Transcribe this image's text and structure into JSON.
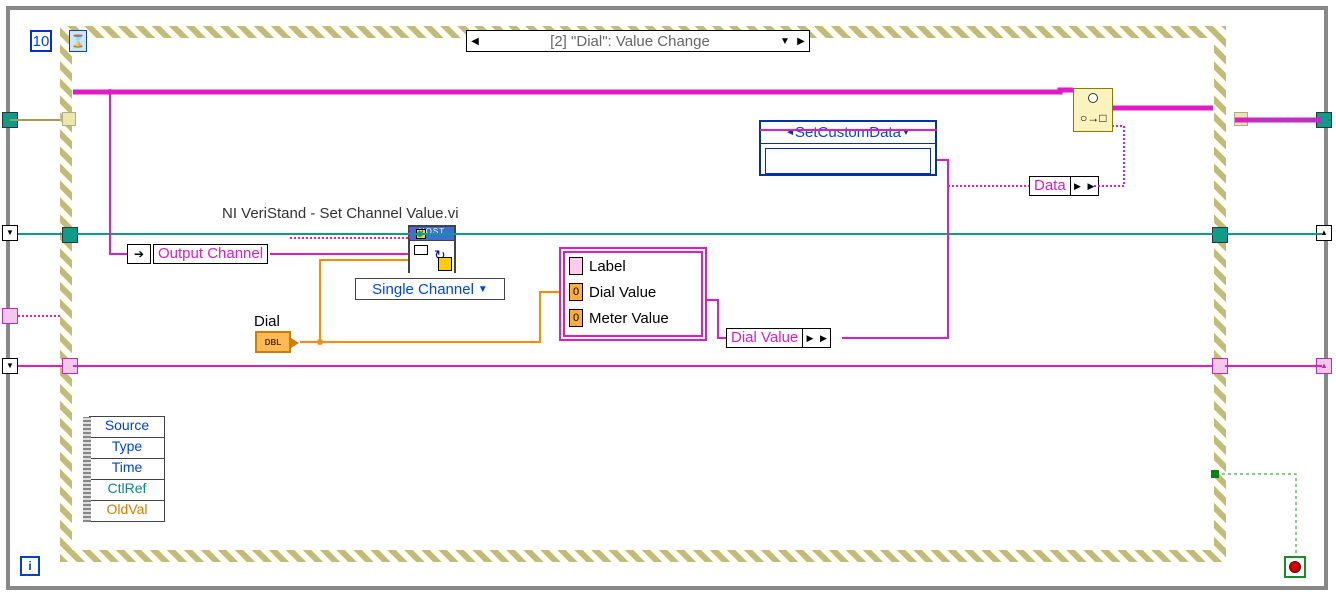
{
  "loop": {
    "wait_ms": "10",
    "iteration_glyph": "i",
    "hourglass_glyph": "⌛"
  },
  "case": {
    "index": "[2]",
    "name": "\"Dial\": Value Change"
  },
  "subvi": {
    "label": "NI VeriStand - Set Channel Value.vi",
    "banner": "HOST",
    "polymorphic": "Single Channel"
  },
  "terminals": {
    "output_channel": "Output Channel",
    "dial_control_label": "Dial",
    "dial_type": "DBL"
  },
  "cluster": {
    "items": {
      "0": "Label",
      "1": "Dial Value",
      "2": "Meter Value"
    },
    "digit": "0"
  },
  "bundle_out": "Dial Value",
  "invoke": {
    "method": "SetCustomData"
  },
  "data_term": "Data",
  "event_data": {
    "0": "Source",
    "1": "Type",
    "2": "Time",
    "3": "CtlRef",
    "4": "OldVal"
  }
}
